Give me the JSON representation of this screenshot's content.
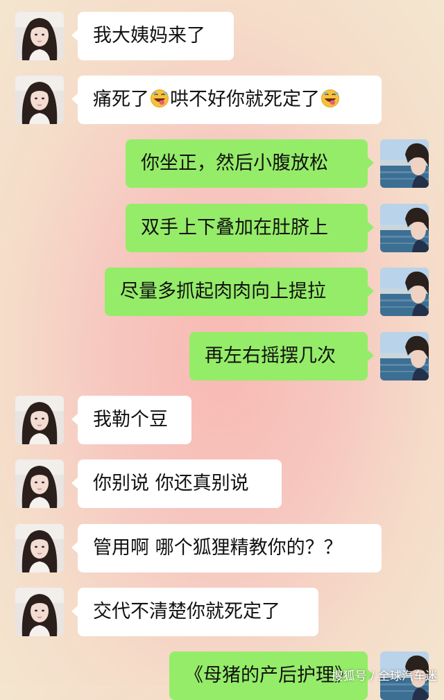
{
  "messages": [
    {
      "side": "left",
      "text": "我大姨妈来了"
    },
    {
      "side": "left",
      "text_before": "痛死了",
      "text_middle": "哄不好你就死定了",
      "emoji": "tongue-out-laughing-emoji"
    },
    {
      "side": "right",
      "text": "你坐正，然后小腹放松"
    },
    {
      "side": "right",
      "text": "双手上下叠加在肚脐上"
    },
    {
      "side": "right",
      "text": "尽量多抓起肉肉向上提拉"
    },
    {
      "side": "right",
      "text": "再左右摇摆几次"
    },
    {
      "side": "left",
      "text": "我勒个豆"
    },
    {
      "side": "left",
      "text": "你别说 你还真别说"
    },
    {
      "side": "left",
      "text": "管用啊 哪个狐狸精教你的？？"
    },
    {
      "side": "left",
      "text": "交代不清楚你就死定了"
    },
    {
      "side": "right",
      "text": "《母猪的产后护理》"
    }
  ],
  "avatars": {
    "left": "girl-avatar",
    "right": "boy-seaside-avatar"
  },
  "watermark": "搜狐号 / 全球汽车迷",
  "colors": {
    "sent_bubble": "#95ec69",
    "received_bubble": "#ffffff"
  }
}
